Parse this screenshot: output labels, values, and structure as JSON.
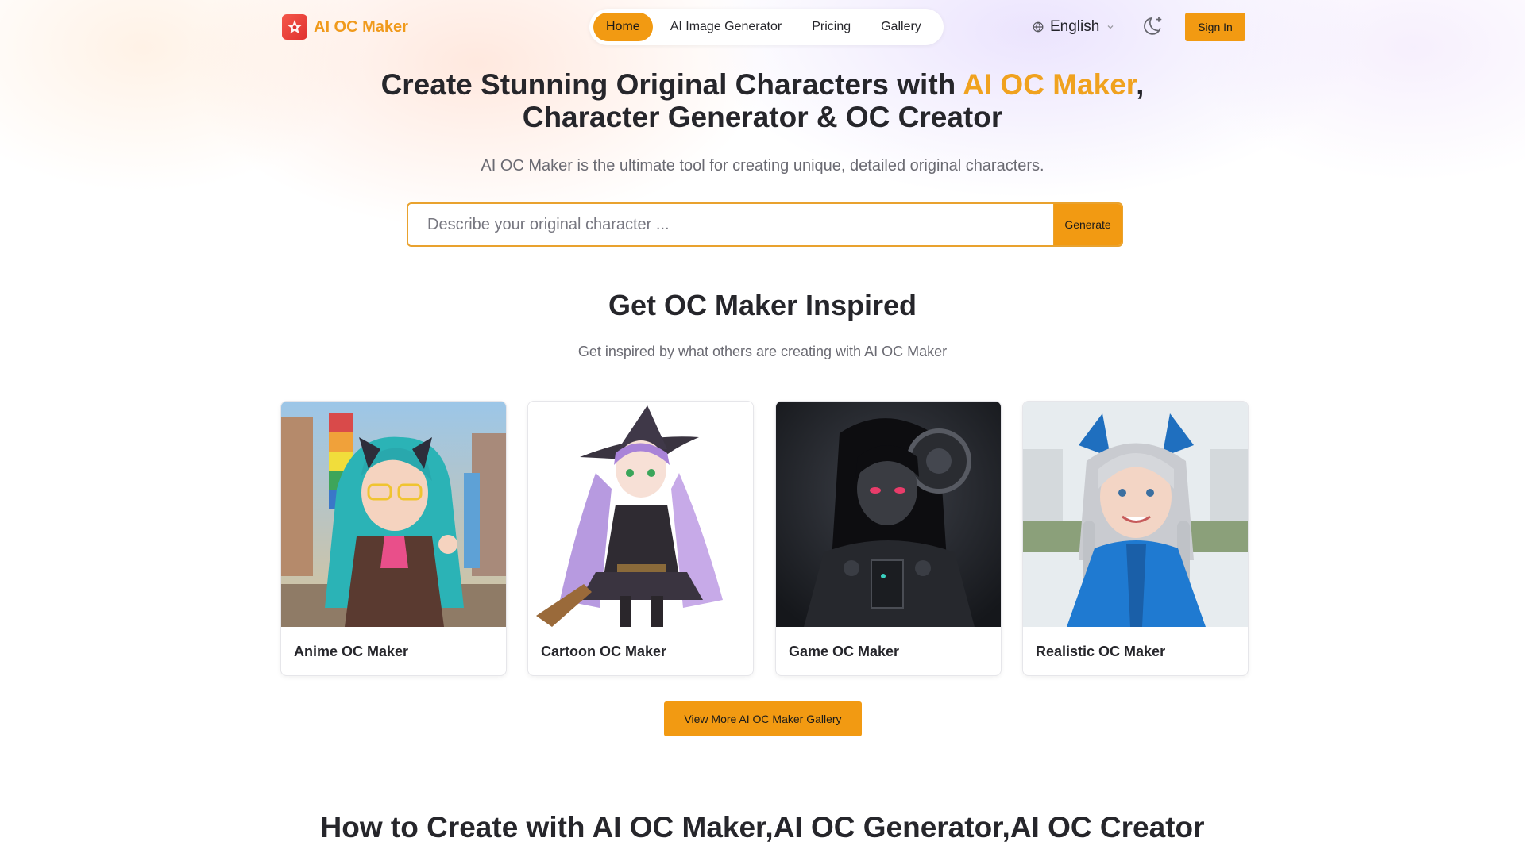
{
  "brand": {
    "name": "AI OC Maker",
    "logo_icon": "star-logo-icon",
    "accent_color": "#f29a12",
    "logo_color": "#e0312f"
  },
  "nav": {
    "items": [
      {
        "label": "Home",
        "active": true
      },
      {
        "label": "AI Image Generator",
        "active": false
      },
      {
        "label": "Pricing",
        "active": false
      },
      {
        "label": "Gallery",
        "active": false
      }
    ]
  },
  "header": {
    "language": "English",
    "language_icon": "globe-icon",
    "theme_icon": "moon-sparkle-icon",
    "signin_label": "Sign In"
  },
  "hero": {
    "title_part1": "Create Stunning Original Characters with ",
    "title_highlight": "AI OC Maker",
    "title_part2": ", Character Generator & OC Creator",
    "subtitle": "AI OC Maker is the ultimate tool for creating unique, detailed original characters.",
    "search_placeholder": "Describe your original character ...",
    "generate_label": "Generate"
  },
  "inspired": {
    "title": "Get OC Maker Inspired",
    "subtitle": "Get inspired by what others are creating with AI OC Maker",
    "cards": [
      {
        "label": "Anime OC Maker"
      },
      {
        "label": "Cartoon OC Maker"
      },
      {
        "label": "Game OC Maker"
      },
      {
        "label": "Realistic OC Maker"
      }
    ],
    "more_label": "View More AI OC Maker Gallery"
  },
  "how": {
    "title": "How to Create with AI OC Maker,AI OC Generator,AI OC Creator"
  }
}
